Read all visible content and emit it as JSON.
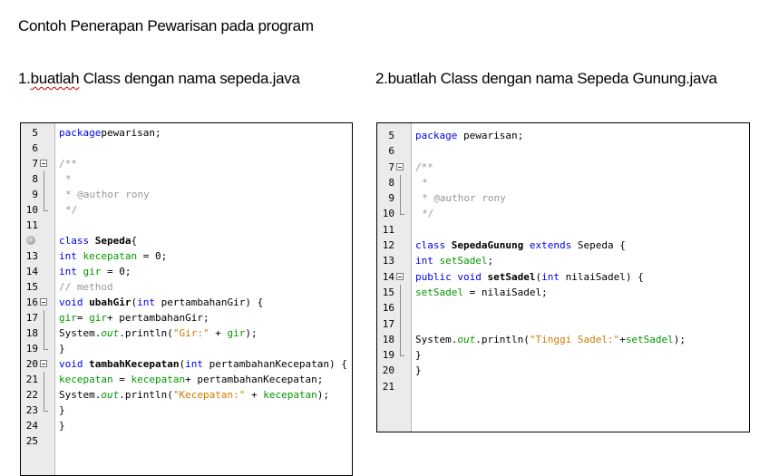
{
  "page": {
    "title": "Contoh Penerapan Pewarisan pada program",
    "label1_prefix": "1.",
    "label1_word": "buatlah",
    "label1_rest": " Class dengan nama sepeda.java",
    "label2": "2.buatlah Class dengan nama Sepeda Gunung.java"
  },
  "editor1": {
    "lines": [
      {
        "n": "5",
        "tokens": [
          [
            "kw",
            "package"
          ],
          [
            "",
            "pewarisan;"
          ]
        ]
      },
      {
        "n": "6",
        "tokens": []
      },
      {
        "n": "7",
        "tokens": [
          [
            "cm",
            "/**"
          ]
        ]
      },
      {
        "n": "8",
        "tokens": [
          [
            "cm",
            "*"
          ]
        ]
      },
      {
        "n": "9",
        "tokens": [
          [
            "cm",
            "* @author rony"
          ]
        ]
      },
      {
        "n": "10",
        "tokens": [
          [
            "cm",
            "*/"
          ]
        ]
      },
      {
        "n": "11",
        "tokens": []
      },
      {
        "n": "",
        "tokens": [
          [
            "kw",
            "class "
          ],
          [
            "bd",
            "Sepeda"
          ],
          [
            "",
            "{"
          ]
        ]
      },
      {
        "n": "13",
        "tokens": [
          [
            "kw",
            "int "
          ],
          [
            "fld",
            "kecepatan"
          ],
          [
            "",
            " = 0;"
          ]
        ]
      },
      {
        "n": "14",
        "tokens": [
          [
            "kw",
            "int "
          ],
          [
            "fld",
            "gir"
          ],
          [
            "",
            " = 0;"
          ]
        ]
      },
      {
        "n": "15",
        "tokens": [
          [
            "cm",
            "// method"
          ]
        ]
      },
      {
        "n": "16",
        "tokens": [
          [
            "kw",
            "void "
          ],
          [
            "bd",
            "ubahGir"
          ],
          [
            "",
            "("
          ],
          [
            "kw",
            "int "
          ],
          [
            "",
            "pertambahanGir) {"
          ]
        ]
      },
      {
        "n": "17",
        "tokens": [
          [
            "fld",
            "gir"
          ],
          [
            "",
            "= "
          ],
          [
            "fld",
            "gir"
          ],
          [
            "",
            "+ pertambahanGir;"
          ]
        ]
      },
      {
        "n": "18",
        "tokens": [
          [
            "",
            "System."
          ],
          [
            "fld it",
            "out"
          ],
          [
            "",
            ".println("
          ],
          [
            "st",
            "\"Gir:\""
          ],
          [
            "",
            " + "
          ],
          [
            "fld",
            "gir"
          ],
          [
            "",
            ");"
          ]
        ]
      },
      {
        "n": "19",
        "tokens": [
          [
            "",
            "}"
          ]
        ]
      },
      {
        "n": "20",
        "tokens": [
          [
            "kw",
            "void "
          ],
          [
            "bd",
            "tambahKecepatan"
          ],
          [
            "",
            "("
          ],
          [
            "kw",
            "int "
          ],
          [
            "",
            "pertambahanKecepatan) {"
          ]
        ]
      },
      {
        "n": "21",
        "tokens": [
          [
            "fld",
            "kecepatan"
          ],
          [
            "",
            " = "
          ],
          [
            "fld",
            "kecepatan"
          ],
          [
            "",
            "+ pertambahanKecepatan;"
          ]
        ]
      },
      {
        "n": "22",
        "tokens": [
          [
            "",
            "System."
          ],
          [
            "fld it",
            "out"
          ],
          [
            "",
            ".println("
          ],
          [
            "st",
            "\"Kecepatan:\""
          ],
          [
            "",
            " + "
          ],
          [
            "fld",
            "kecepatan"
          ],
          [
            "",
            ");"
          ]
        ]
      },
      {
        "n": "23",
        "tokens": [
          [
            "",
            "}"
          ]
        ]
      },
      {
        "n": "24",
        "tokens": [
          [
            "",
            "}"
          ]
        ]
      },
      {
        "n": "25",
        "tokens": []
      }
    ]
  },
  "editor2": {
    "lines": [
      {
        "n": "5",
        "tokens": [
          [
            "kw",
            "package"
          ],
          [
            "",
            " pewarisan;"
          ]
        ]
      },
      {
        "n": "6",
        "tokens": []
      },
      {
        "n": "7",
        "tokens": [
          [
            "cm",
            "/**"
          ]
        ]
      },
      {
        "n": "8",
        "tokens": [
          [
            "cm",
            "*"
          ]
        ]
      },
      {
        "n": "9",
        "tokens": [
          [
            "cm",
            "* @author rony"
          ]
        ]
      },
      {
        "n": "10",
        "tokens": [
          [
            "cm",
            "*/"
          ]
        ]
      },
      {
        "n": "11",
        "tokens": []
      },
      {
        "n": "12",
        "tokens": [
          [
            "kw",
            "class "
          ],
          [
            "bd",
            "SepedaGunung"
          ],
          [
            "kw",
            " extends "
          ],
          [
            "",
            "Sepeda {"
          ]
        ]
      },
      {
        "n": "13",
        "tokens": [
          [
            "kw",
            "int "
          ],
          [
            "fld",
            "setSadel"
          ],
          [
            "",
            ";"
          ]
        ]
      },
      {
        "n": "14",
        "tokens": [
          [
            "kw",
            "public void "
          ],
          [
            "bd",
            "setSadel"
          ],
          [
            "",
            "("
          ],
          [
            "kw",
            "int "
          ],
          [
            "",
            "nilaiSadel) {"
          ]
        ]
      },
      {
        "n": "15",
        "tokens": [
          [
            "fld",
            "setSadel"
          ],
          [
            "",
            " = nilaiSadel;"
          ]
        ]
      },
      {
        "n": "16",
        "tokens": []
      },
      {
        "n": "17",
        "tokens": []
      },
      {
        "n": "18",
        "tokens": [
          [
            "",
            "System."
          ],
          [
            "fld it",
            "out"
          ],
          [
            "",
            ".println("
          ],
          [
            "st",
            "\"Tinggi Sadel:\""
          ],
          [
            "",
            "+"
          ],
          [
            "fld",
            "setSadel"
          ],
          [
            "",
            ");"
          ]
        ]
      },
      {
        "n": "19",
        "tokens": [
          [
            "",
            "}"
          ]
        ]
      },
      {
        "n": "20",
        "tokens": [
          [
            "",
            "}"
          ]
        ]
      },
      {
        "n": "21",
        "tokens": []
      }
    ]
  }
}
